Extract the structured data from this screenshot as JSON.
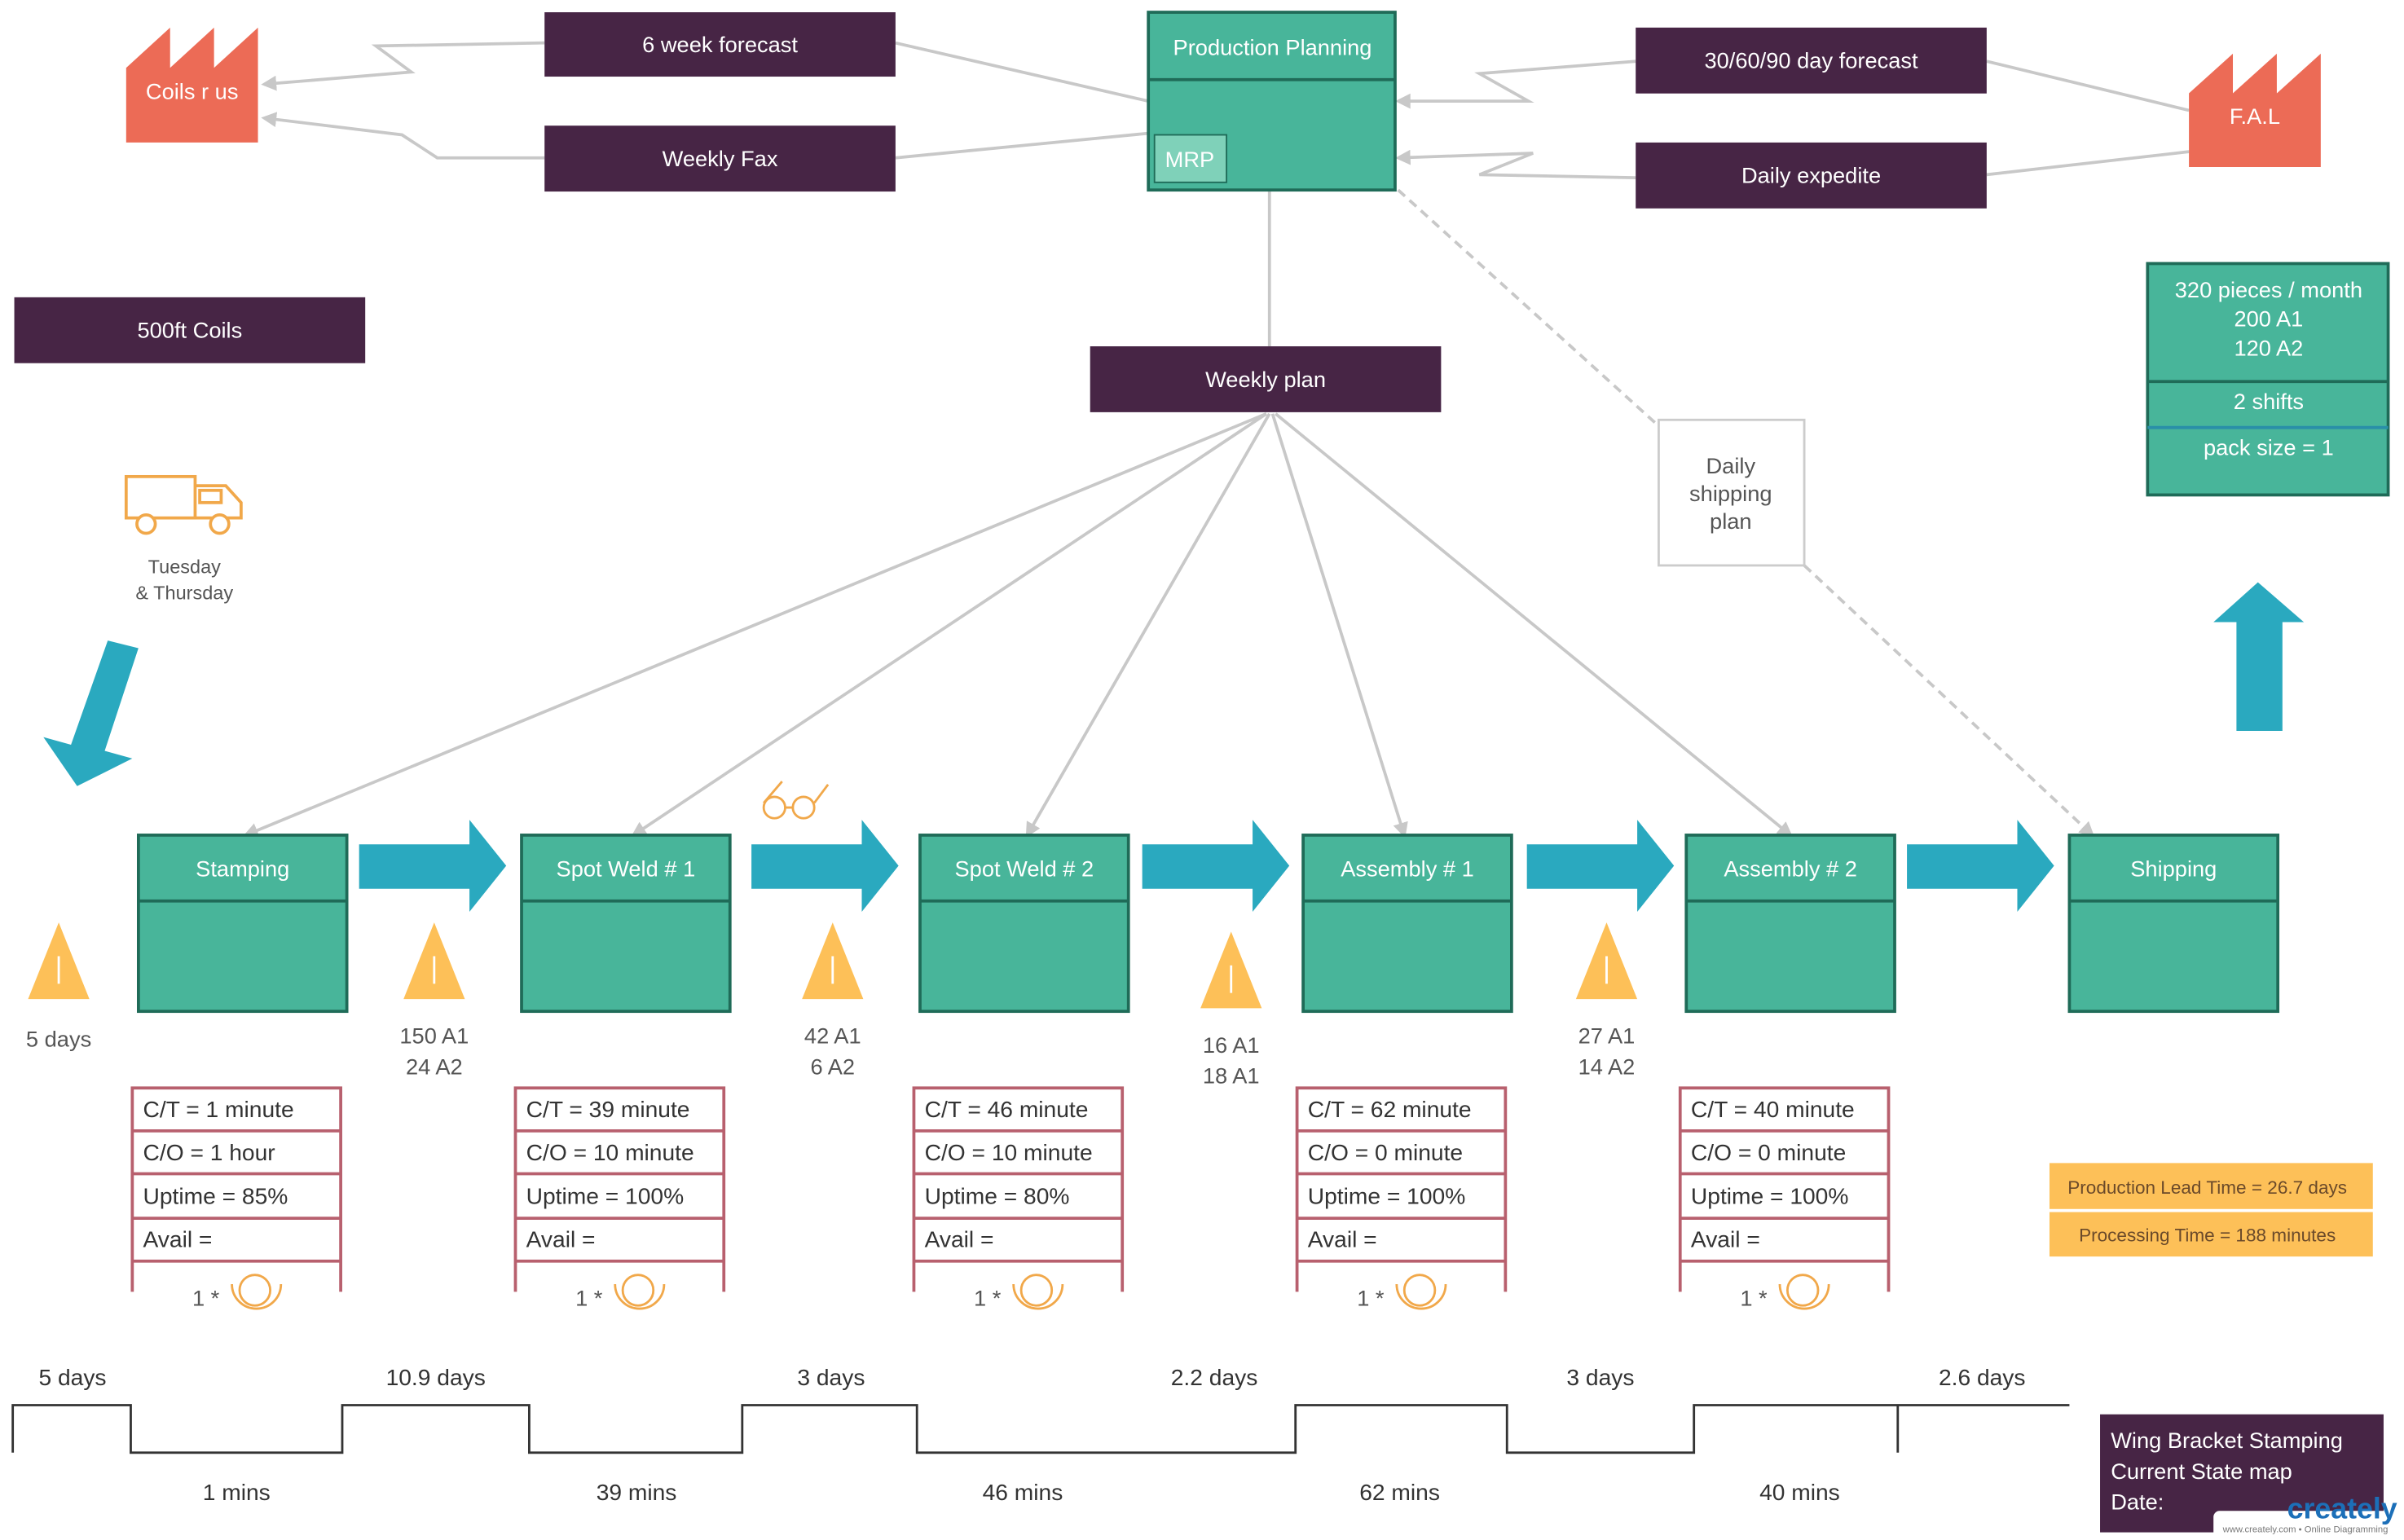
{
  "colors": {
    "dark": "#472545",
    "teal": "#48b59a",
    "factory": "#ec6b56",
    "arrow": "#2aa9bf",
    "inventory": "#fdc058",
    "databox": "#b8606e",
    "operator": "#f1a84a"
  },
  "suppliers": {
    "label": "Coils r us",
    "icon": "factory-icon"
  },
  "customer": {
    "label": "F.A.L",
    "icon": "factory-icon"
  },
  "info": {
    "six_week": "6 week forecast",
    "weekly_fax": "Weekly Fax",
    "forecast_306090": "30/60/90 day forecast",
    "daily_expedite": "Daily expedite",
    "weekly_plan": "Weekly plan",
    "coils": "500ft Coils",
    "daily_shipping": [
      "Daily",
      "shipping",
      "plan"
    ]
  },
  "control": {
    "title": "Production Planning",
    "mrp": "MRP"
  },
  "shipment": {
    "icon": "truck-icon",
    "line1": "Tuesday",
    "line2": "& Thursday"
  },
  "customer_data": {
    "line1": "320 pieces / month",
    "line2": "200 A1",
    "line3": "120 A2",
    "shifts": "2 shifts",
    "pack": "pack size = 1"
  },
  "processes": [
    {
      "name": "Stamping",
      "ct": "C/T = 1 minute",
      "co": "C/O =  1 hour",
      "uptime": "Uptime =  85%",
      "avail": "Avail =",
      "operators": "1 *"
    },
    {
      "name": "Spot Weld # 1",
      "ct": "C/T = 39 minute",
      "co": "C/O = 10 minute",
      "uptime": "Uptime = 100%",
      "avail": "Avail =",
      "operators": "1 *"
    },
    {
      "name": "Spot Weld # 2",
      "ct": "C/T = 46 minute",
      "co": "C/O = 10 minute",
      "uptime": "Uptime = 80%",
      "avail": "Avail =",
      "operators": "1 *"
    },
    {
      "name": "Assembly # 1",
      "ct": "C/T = 62 minute",
      "co": "C/O = 0 minute",
      "uptime": "Uptime = 100%",
      "avail": "Avail =",
      "operators": "1 *"
    },
    {
      "name": "Assembly # 2",
      "ct": "C/T = 40 minute",
      "co": "C/O = 0 minute",
      "uptime": "Uptime = 100%",
      "avail": "Avail =",
      "operators": "1 *"
    },
    {
      "name": "Shipping"
    }
  ],
  "inventory": [
    {
      "lines": [
        "5 days"
      ]
    },
    {
      "lines": [
        "150 A1",
        "24 A2"
      ]
    },
    {
      "lines": [
        "42 A1",
        "6 A2"
      ]
    },
    {
      "lines": [
        "16 A1",
        "18 A1"
      ]
    },
    {
      "lines": [
        "27 A1",
        "14 A2"
      ]
    }
  ],
  "timeline": {
    "wait": [
      "5 days",
      "10.9 days",
      "3 days",
      "2.2 days",
      "3 days",
      "2.6 days"
    ],
    "process": [
      "1 mins",
      "39 mins",
      "46 mins",
      "62 mins",
      "40 mins"
    ]
  },
  "summary": {
    "lead_time": "Production Lead Time = 26.7 days",
    "processing": "Processing Time = 188 minutes"
  },
  "title_box": {
    "line1": "Wing Bracket Stamping",
    "line2": "Current State map",
    "line3": "Date:"
  },
  "logo": {
    "name": "creately",
    "tagline": "www.creately.com • Online Diagramming"
  }
}
